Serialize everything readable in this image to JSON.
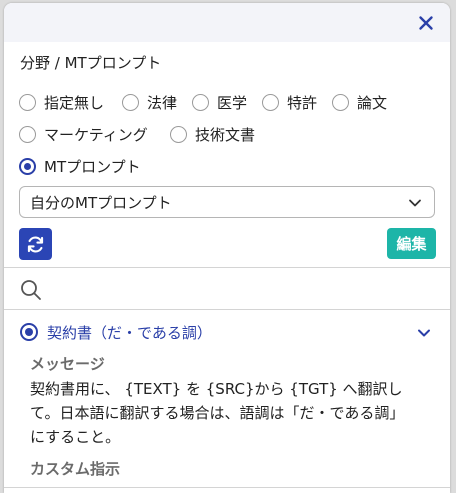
{
  "section_title": "分野 / MTプロンプト",
  "radio_options": [
    {
      "label": "指定無し",
      "checked": false
    },
    {
      "label": "法律",
      "checked": false
    },
    {
      "label": "医学",
      "checked": false
    },
    {
      "label": "特許",
      "checked": false
    },
    {
      "label": "論文",
      "checked": false
    },
    {
      "label": "マーケティング",
      "checked": false
    },
    {
      "label": "技術文書",
      "checked": false
    },
    {
      "label": "MTプロンプト",
      "checked": true
    }
  ],
  "prompt_select": {
    "value": "自分のMTプロンプト"
  },
  "edit_button": {
    "label": "編集"
  },
  "selected_prompt": {
    "label": "契約書（だ・である調）"
  },
  "message": {
    "heading": "メッセージ",
    "line1": "契約書用に、 {TEXT} を {SRC}から {TGT} へ翻訳し",
    "line2": "て。日本語に翻訳する場合は、語調は「だ・である調」",
    "line3": "にすること。"
  },
  "custom_instruction": {
    "heading": "カスタム指示"
  },
  "colors": {
    "accent": "#2a3fa8",
    "edit_button": "#1db5a8",
    "refresh_button": "#2b45b5"
  }
}
